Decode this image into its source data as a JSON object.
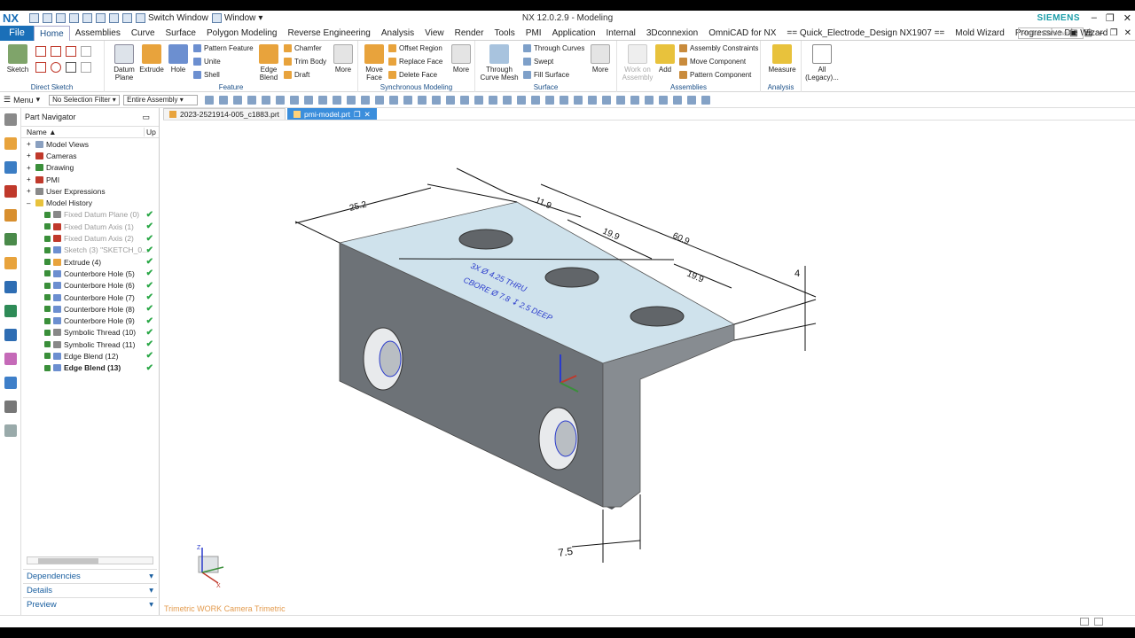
{
  "titlebar": {
    "logo": "NX",
    "switch_window": "Switch Window",
    "window": "Window",
    "title": "NX 12.0.2.9 - Modeling",
    "brand": "SIEMENS"
  },
  "menubar": {
    "file": "File",
    "tabs": [
      "Home",
      "Assemblies",
      "Curve",
      "Surface",
      "Polygon Modeling",
      "Reverse Engineering",
      "Analysis",
      "View",
      "Render",
      "Tools",
      "PMI",
      "Application",
      "Internal",
      "3Dconnexion",
      "OmniCAD for NX",
      "== Quick_Electrode_Design NX1907 ==",
      "Mold Wizard",
      "Progressive Die Wizard"
    ],
    "active_tab": "Home",
    "find_placeholder": "Find a Command"
  },
  "ribbon": {
    "direct_sketch": {
      "name": "Direct Sketch",
      "sketch": "Sketch"
    },
    "feature": {
      "name": "Feature",
      "datum_plane": "Datum Plane",
      "extrude": "Extrude",
      "hole": "Hole",
      "pattern_feature": "Pattern Feature",
      "unite": "Unite",
      "shell": "Shell",
      "edge_blend": "Edge Blend",
      "chamfer": "Chamfer",
      "trim_body": "Trim Body",
      "draft": "Draft",
      "more": "More"
    },
    "sync": {
      "name": "Synchronous Modeling",
      "move_face": "Move Face",
      "offset_region": "Offset Region",
      "replace_face": "Replace Face",
      "delete_face": "Delete Face",
      "more": "More"
    },
    "surface": {
      "name": "Surface",
      "through_curve_mesh": "Through Curve Mesh",
      "through_curves": "Through Curves",
      "swept": "Swept",
      "fill_surface": "Fill Surface",
      "more": "More"
    },
    "assemblies": {
      "name": "Assemblies",
      "work_on_assembly": "Work on Assembly",
      "add": "Add",
      "assembly_constraints": "Assembly Constraints",
      "move_component": "Move Component",
      "pattern_component": "Pattern Component"
    },
    "analysis": {
      "name": "Analysis",
      "measure": "Measure"
    },
    "all_legacy": "All (Legacy)..."
  },
  "toolbar2": {
    "menu": "Menu",
    "selection_filter": "No Selection Filter",
    "scope": "Entire Assembly"
  },
  "navigator": {
    "title": "Part Navigator",
    "col_name": "Name",
    "col_up": "Up",
    "rows": [
      {
        "label": "Model Views",
        "style": "normal",
        "ok": false
      },
      {
        "label": "Cameras",
        "style": "normal",
        "ok": false
      },
      {
        "label": "Drawing",
        "style": "normal",
        "ok": false
      },
      {
        "label": "PMI",
        "style": "normal",
        "ok": false
      },
      {
        "label": "User Expressions",
        "style": "normal",
        "ok": false
      },
      {
        "label": "Model History",
        "style": "normal",
        "ok": false
      },
      {
        "label": "Fixed Datum Plane (0)",
        "style": "dim",
        "ok": true
      },
      {
        "label": "Fixed Datum Axis (1)",
        "style": "dim",
        "ok": true
      },
      {
        "label": "Fixed Datum Axis (2)",
        "style": "dim",
        "ok": true
      },
      {
        "label": "Sketch (3) \"SKETCH_0...",
        "style": "dim",
        "ok": true
      },
      {
        "label": "Extrude (4)",
        "style": "normal",
        "ok": true
      },
      {
        "label": "Counterbore Hole (5)",
        "style": "normal",
        "ok": true
      },
      {
        "label": "Counterbore Hole (6)",
        "style": "normal",
        "ok": true
      },
      {
        "label": "Counterbore Hole (7)",
        "style": "normal",
        "ok": true
      },
      {
        "label": "Counterbore Hole (8)",
        "style": "normal",
        "ok": true
      },
      {
        "label": "Counterbore Hole (9)",
        "style": "normal",
        "ok": true
      },
      {
        "label": "Symbolic Thread (10)",
        "style": "normal",
        "ok": true
      },
      {
        "label": "Symbolic Thread (11)",
        "style": "normal",
        "ok": true
      },
      {
        "label": "Edge Blend (12)",
        "style": "normal",
        "ok": true
      },
      {
        "label": "Edge Blend (13)",
        "style": "bold",
        "ok": true
      }
    ],
    "panels": [
      "Dependencies",
      "Details",
      "Preview"
    ]
  },
  "graphics": {
    "tabs": [
      "2023-2521914-005_c1883.prt",
      "pmi-model.prt"
    ],
    "active_tab": 1,
    "dims": {
      "d1": "25.2",
      "d2": "11.9",
      "d3": "19.9",
      "d4": "60.9",
      "d5": "19.9",
      "d6": "4",
      "d7": "7.5"
    },
    "note_line1": "3X  Ø 4.25 THRU",
    "note_line2": "CBORE Ø 7.8 ↧ 2.5 DEEP",
    "camera_label": "Trimetric WORK Camera Trimetric",
    "triad": {
      "z": "Z",
      "x": "X",
      "y": "Y"
    }
  },
  "colors": {
    "accent": "#1a6fb8",
    "active_tab": "#3b8edc",
    "pmi_blue": "#2a3bcc",
    "model_gray": "#6f7479",
    "top_face": "#cfe2ec",
    "ok_green": "#28a745"
  }
}
